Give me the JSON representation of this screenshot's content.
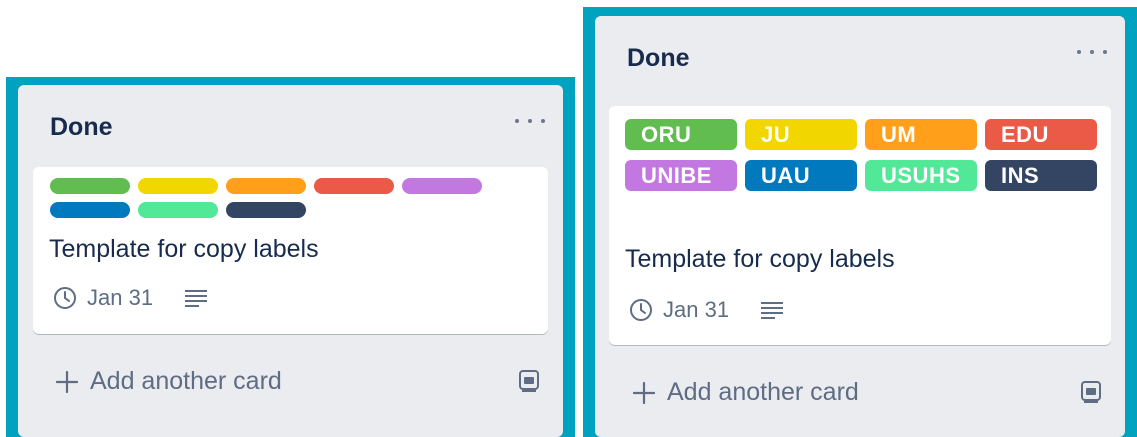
{
  "panels": [
    {
      "list_title": "Done",
      "label_colors": [
        "#61bd4f",
        "#f2d600",
        "#ff9f1a",
        "#eb5a46",
        "#c377e0",
        "#0079bf",
        "#51e898",
        "#344563"
      ],
      "card_title": "Template for copy labels",
      "due_date": "Jan 31",
      "add_card_label": "Add another card"
    },
    {
      "list_title": "Done",
      "labels": [
        {
          "text": "ORU",
          "color": "#61bd4f"
        },
        {
          "text": "JU",
          "color": "#f2d600"
        },
        {
          "text": "UM",
          "color": "#ff9f1a"
        },
        {
          "text": "EDU",
          "color": "#eb5a46"
        },
        {
          "text": "UNIBE",
          "color": "#c377e0"
        },
        {
          "text": "UAU",
          "color": "#0079bf"
        },
        {
          "text": "USUHS",
          "color": "#51e898"
        },
        {
          "text": "INS",
          "color": "#344563"
        }
      ],
      "card_title": "Template for copy labels",
      "due_date": "Jan 31",
      "add_card_label": "Add another card"
    }
  ],
  "icons": {
    "more": "more-horizontal-icon",
    "due": "clock-icon",
    "description": "description-icon",
    "add": "plus-icon",
    "template": "card-template-icon"
  },
  "colors": {
    "selection_border": "#00a3bf",
    "list_background": "#ebecf0",
    "text_primary": "#172b4d",
    "text_secondary": "#5e6c84"
  }
}
